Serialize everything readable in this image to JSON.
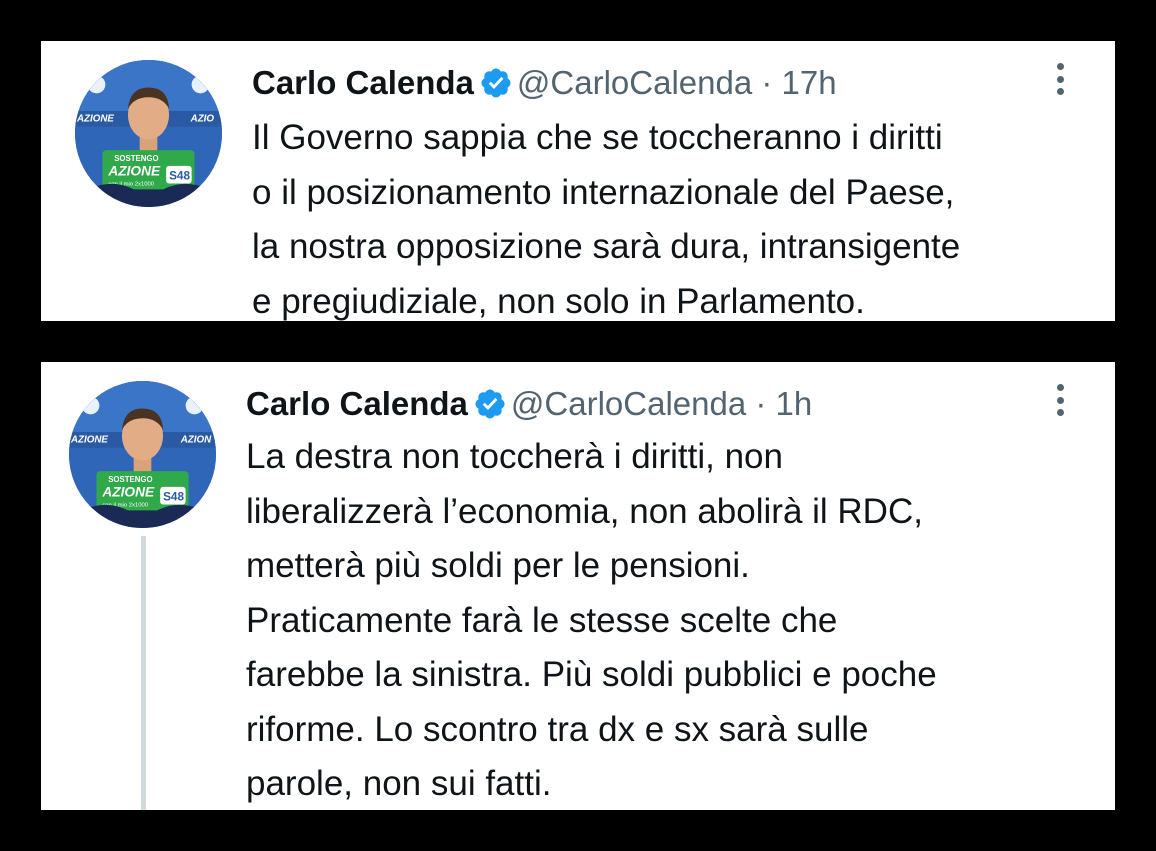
{
  "colors": {
    "background": "#000000",
    "card": "#ffffff",
    "text": "#0f1419",
    "secondary_text": "#536471",
    "verified_badge": "#1d9bf0",
    "thread_line": "#cfd9de"
  },
  "tweets": [
    {
      "author_name": "Carlo Calenda",
      "verified_icon": "verified-badge-icon",
      "handle": "@CarloCalenda",
      "separator": "·",
      "time": "17h",
      "more_icon": "more-options-icon",
      "avatar_texts": {
        "logo_left": "AZIONE",
        "logo_right": "AZIO",
        "sign_top": "SOSTENGO",
        "sign_main": "AZIONE",
        "sign_sub": "con il mio 2x1000",
        "sign_code": "S48"
      },
      "lines": [
        "Il Governo sappia che se toccheranno i diritti",
        "o il posizionamento internazionale del Paese,",
        "la nostra opposizione sarà dura, intransigente",
        "e pregiudiziale, non solo in Parlamento."
      ]
    },
    {
      "author_name": "Carlo Calenda",
      "verified_icon": "verified-badge-icon",
      "handle": "@CarloCalenda",
      "separator": "·",
      "time": "1h",
      "more_icon": "more-options-icon",
      "avatar_texts": {
        "logo_left": "AZIONE",
        "logo_right": "AZION",
        "sign_top": "SOSTENGO",
        "sign_main": "AZIONE",
        "sign_sub": "con il mio 2x1000",
        "sign_code": "S48"
      },
      "lines": [
        "La destra non toccherà i diritti, non",
        "liberalizzerà l’economia, non abolirà il RDC,",
        "metterà più soldi per le pensioni.",
        "Praticamente farà le stesse scelte che",
        "farebbe la sinistra. Più soldi pubblici e poche",
        "riforme. Lo scontro tra dx e sx sarà sulle",
        "parole, non sui fatti."
      ]
    }
  ]
}
